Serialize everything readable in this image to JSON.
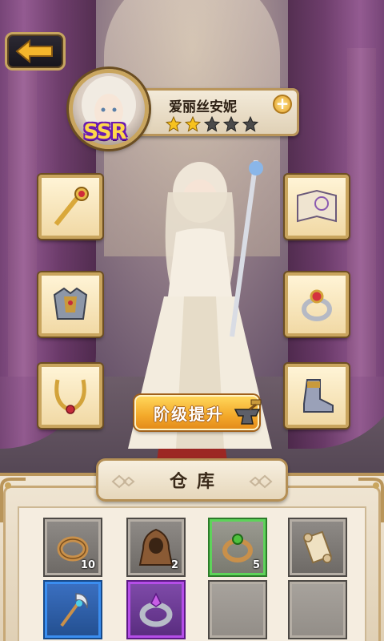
{
  "hero": {
    "name": "爱丽丝安妮",
    "rarity": "SSR",
    "stars_filled": 2,
    "stars_total": 5,
    "plus_symbol": "+"
  },
  "equipment": {
    "left": [
      "staff-head-icon",
      "armor-icon",
      "necklace-icon"
    ],
    "right": [
      "spellbook-icon",
      "ring-icon",
      "boots-icon"
    ]
  },
  "upgrade": {
    "label": "阶级提升"
  },
  "warehouse": {
    "title": "仓库",
    "items": [
      {
        "icon": "bronze-ring-icon",
        "qty": "10",
        "rarity": "common"
      },
      {
        "icon": "hood-cloak-icon",
        "qty": "2",
        "rarity": "common"
      },
      {
        "icon": "green-gem-ring-icon",
        "qty": "5",
        "rarity": "green"
      },
      {
        "icon": "scroll-icon",
        "qty": "",
        "rarity": "common"
      },
      {
        "icon": "crescent-staff-icon",
        "qty": "",
        "rarity": "blue"
      },
      {
        "icon": "crystal-ring-icon",
        "qty": "",
        "rarity": "purple"
      },
      {
        "icon": "empty-slot",
        "qty": "",
        "rarity": "empty"
      },
      {
        "icon": "empty-slot",
        "qty": "",
        "rarity": "empty"
      }
    ]
  },
  "colors": {
    "gold_frame": "#c9a55e",
    "upgrade_orange": "#f3a92a",
    "curtain_purple": "#9b5c98",
    "rarity_green": "#5ed35a",
    "rarity_blue": "#3b8ef0",
    "rarity_purple": "#b54ee8"
  }
}
